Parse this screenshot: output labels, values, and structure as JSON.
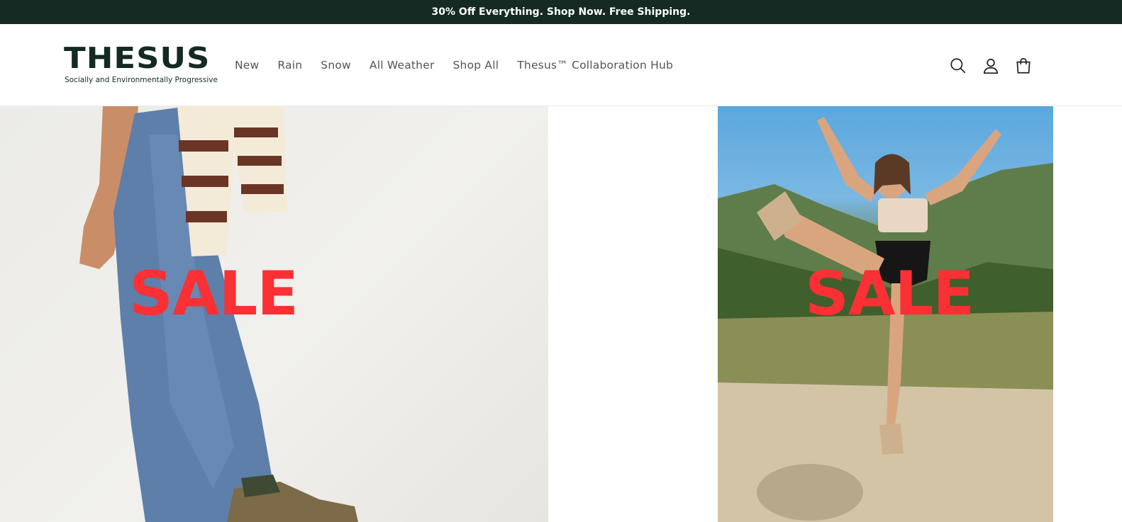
{
  "announcement": {
    "text": "30% Off Everything. Shop Now. Free Shipping."
  },
  "brand": {
    "name": "THESUS",
    "tagline": "Socially and Environmentally Progressive"
  },
  "nav": {
    "items": [
      {
        "label": "New"
      },
      {
        "label": "Rain"
      },
      {
        "label": "Snow"
      },
      {
        "label": "All Weather"
      },
      {
        "label": "Shop All"
      },
      {
        "label": "Thesus™ Collaboration Hub"
      }
    ]
  },
  "header_icons": [
    "search-icon",
    "account-icon",
    "cart-icon"
  ],
  "hero": {
    "left": {
      "overlay_text": "SALE",
      "image": "model in jeans, striped sweater and hiking boots"
    },
    "right": {
      "overlay_text": "SALE",
      "image": "woman kicking leg up on mountain trail"
    }
  },
  "colors": {
    "announcement_bg": "#142a22",
    "brand": "#142a22",
    "sale_red": "#fb3034",
    "nav_text": "#4f5753"
  }
}
